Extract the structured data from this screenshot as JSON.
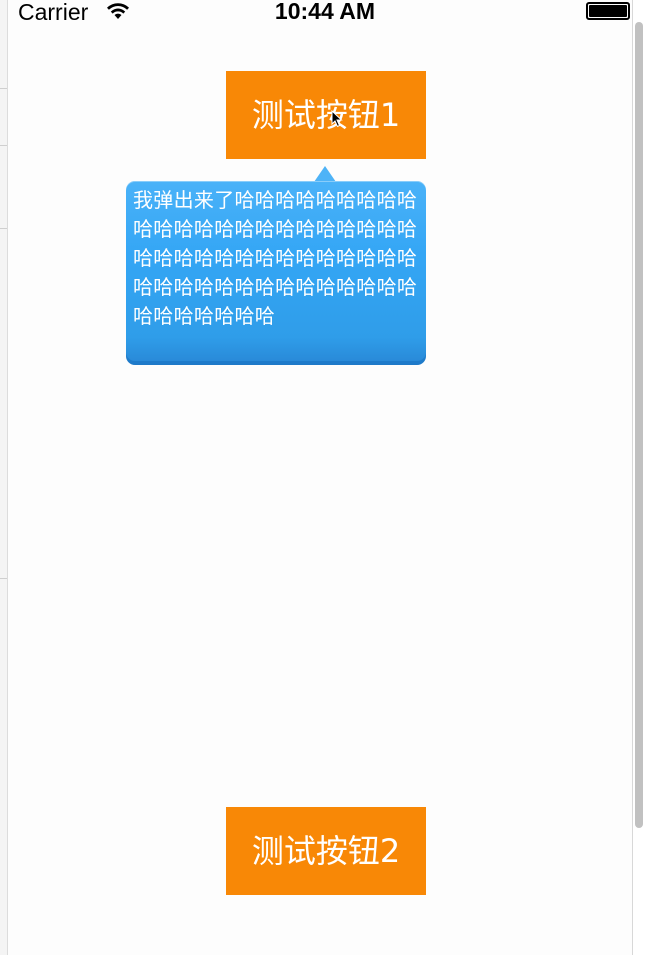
{
  "status_bar": {
    "carrier": "Carrier",
    "time": "10:44 AM",
    "wifi_icon": "wifi-icon",
    "battery_icon": "battery-icon"
  },
  "buttons": {
    "button1_label": "测试按钮1",
    "button2_label": "测试按钮2",
    "color": "#f88806"
  },
  "popover": {
    "text": "我弹出来了哈哈哈哈哈哈哈哈哈哈哈哈哈哈哈哈哈哈哈哈哈哈哈哈哈哈哈哈哈哈哈哈哈哈哈哈哈哈哈哈哈哈哈哈哈哈哈哈哈哈哈哈哈哈哈哈哈哈",
    "color": "#34a6f5"
  }
}
